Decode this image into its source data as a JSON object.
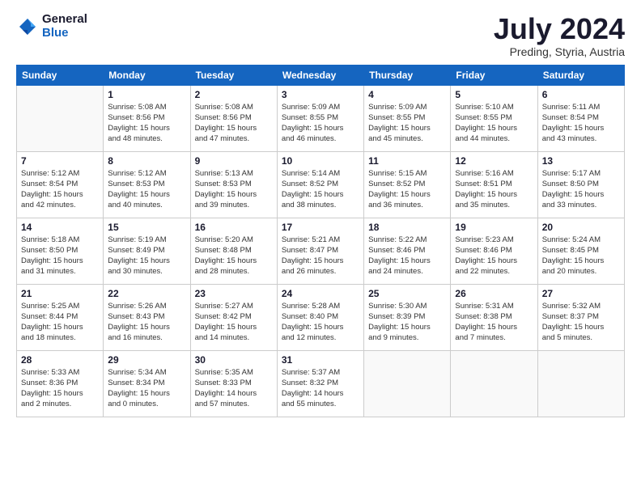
{
  "header": {
    "logo_general": "General",
    "logo_blue": "Blue",
    "month_title": "July 2024",
    "location": "Preding, Styria, Austria"
  },
  "weekdays": [
    "Sunday",
    "Monday",
    "Tuesday",
    "Wednesday",
    "Thursday",
    "Friday",
    "Saturday"
  ],
  "weeks": [
    [
      {
        "day": "",
        "info": ""
      },
      {
        "day": "1",
        "info": "Sunrise: 5:08 AM\nSunset: 8:56 PM\nDaylight: 15 hours\nand 48 minutes."
      },
      {
        "day": "2",
        "info": "Sunrise: 5:08 AM\nSunset: 8:56 PM\nDaylight: 15 hours\nand 47 minutes."
      },
      {
        "day": "3",
        "info": "Sunrise: 5:09 AM\nSunset: 8:55 PM\nDaylight: 15 hours\nand 46 minutes."
      },
      {
        "day": "4",
        "info": "Sunrise: 5:09 AM\nSunset: 8:55 PM\nDaylight: 15 hours\nand 45 minutes."
      },
      {
        "day": "5",
        "info": "Sunrise: 5:10 AM\nSunset: 8:55 PM\nDaylight: 15 hours\nand 44 minutes."
      },
      {
        "day": "6",
        "info": "Sunrise: 5:11 AM\nSunset: 8:54 PM\nDaylight: 15 hours\nand 43 minutes."
      }
    ],
    [
      {
        "day": "7",
        "info": "Sunrise: 5:12 AM\nSunset: 8:54 PM\nDaylight: 15 hours\nand 42 minutes."
      },
      {
        "day": "8",
        "info": "Sunrise: 5:12 AM\nSunset: 8:53 PM\nDaylight: 15 hours\nand 40 minutes."
      },
      {
        "day": "9",
        "info": "Sunrise: 5:13 AM\nSunset: 8:53 PM\nDaylight: 15 hours\nand 39 minutes."
      },
      {
        "day": "10",
        "info": "Sunrise: 5:14 AM\nSunset: 8:52 PM\nDaylight: 15 hours\nand 38 minutes."
      },
      {
        "day": "11",
        "info": "Sunrise: 5:15 AM\nSunset: 8:52 PM\nDaylight: 15 hours\nand 36 minutes."
      },
      {
        "day": "12",
        "info": "Sunrise: 5:16 AM\nSunset: 8:51 PM\nDaylight: 15 hours\nand 35 minutes."
      },
      {
        "day": "13",
        "info": "Sunrise: 5:17 AM\nSunset: 8:50 PM\nDaylight: 15 hours\nand 33 minutes."
      }
    ],
    [
      {
        "day": "14",
        "info": "Sunrise: 5:18 AM\nSunset: 8:50 PM\nDaylight: 15 hours\nand 31 minutes."
      },
      {
        "day": "15",
        "info": "Sunrise: 5:19 AM\nSunset: 8:49 PM\nDaylight: 15 hours\nand 30 minutes."
      },
      {
        "day": "16",
        "info": "Sunrise: 5:20 AM\nSunset: 8:48 PM\nDaylight: 15 hours\nand 28 minutes."
      },
      {
        "day": "17",
        "info": "Sunrise: 5:21 AM\nSunset: 8:47 PM\nDaylight: 15 hours\nand 26 minutes."
      },
      {
        "day": "18",
        "info": "Sunrise: 5:22 AM\nSunset: 8:46 PM\nDaylight: 15 hours\nand 24 minutes."
      },
      {
        "day": "19",
        "info": "Sunrise: 5:23 AM\nSunset: 8:46 PM\nDaylight: 15 hours\nand 22 minutes."
      },
      {
        "day": "20",
        "info": "Sunrise: 5:24 AM\nSunset: 8:45 PM\nDaylight: 15 hours\nand 20 minutes."
      }
    ],
    [
      {
        "day": "21",
        "info": "Sunrise: 5:25 AM\nSunset: 8:44 PM\nDaylight: 15 hours\nand 18 minutes."
      },
      {
        "day": "22",
        "info": "Sunrise: 5:26 AM\nSunset: 8:43 PM\nDaylight: 15 hours\nand 16 minutes."
      },
      {
        "day": "23",
        "info": "Sunrise: 5:27 AM\nSunset: 8:42 PM\nDaylight: 15 hours\nand 14 minutes."
      },
      {
        "day": "24",
        "info": "Sunrise: 5:28 AM\nSunset: 8:40 PM\nDaylight: 15 hours\nand 12 minutes."
      },
      {
        "day": "25",
        "info": "Sunrise: 5:30 AM\nSunset: 8:39 PM\nDaylight: 15 hours\nand 9 minutes."
      },
      {
        "day": "26",
        "info": "Sunrise: 5:31 AM\nSunset: 8:38 PM\nDaylight: 15 hours\nand 7 minutes."
      },
      {
        "day": "27",
        "info": "Sunrise: 5:32 AM\nSunset: 8:37 PM\nDaylight: 15 hours\nand 5 minutes."
      }
    ],
    [
      {
        "day": "28",
        "info": "Sunrise: 5:33 AM\nSunset: 8:36 PM\nDaylight: 15 hours\nand 2 minutes."
      },
      {
        "day": "29",
        "info": "Sunrise: 5:34 AM\nSunset: 8:34 PM\nDaylight: 15 hours\nand 0 minutes."
      },
      {
        "day": "30",
        "info": "Sunrise: 5:35 AM\nSunset: 8:33 PM\nDaylight: 14 hours\nand 57 minutes."
      },
      {
        "day": "31",
        "info": "Sunrise: 5:37 AM\nSunset: 8:32 PM\nDaylight: 14 hours\nand 55 minutes."
      },
      {
        "day": "",
        "info": ""
      },
      {
        "day": "",
        "info": ""
      },
      {
        "day": "",
        "info": ""
      }
    ]
  ]
}
